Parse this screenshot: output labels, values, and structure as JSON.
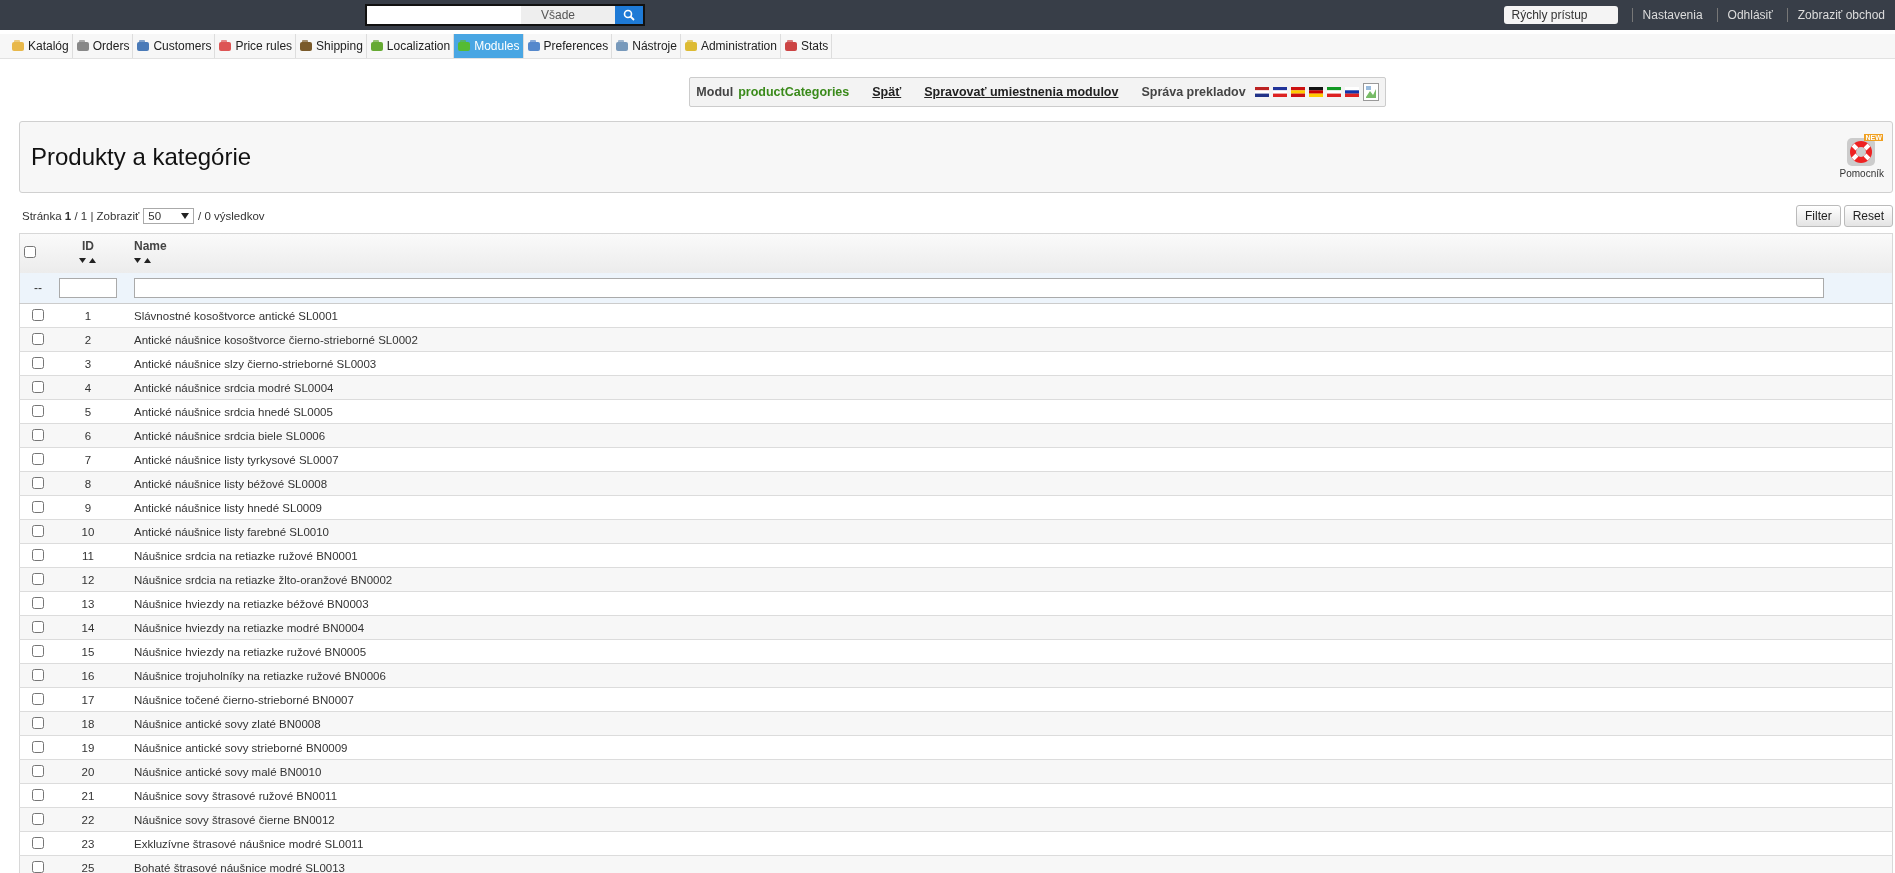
{
  "top_bar": {
    "search": {
      "scope": "Všade"
    },
    "quick_access": "Rýchly prístup",
    "links": [
      "Nastavenia",
      "Odhlásiť",
      "Zobraziť obchod"
    ]
  },
  "tabs": [
    {
      "label": "Katalóg",
      "selected": false
    },
    {
      "label": "Orders",
      "selected": false
    },
    {
      "label": "Customers",
      "selected": false
    },
    {
      "label": "Price rules",
      "selected": false
    },
    {
      "label": "Shipping",
      "selected": false
    },
    {
      "label": "Localization",
      "selected": false
    },
    {
      "label": "Modules",
      "selected": true
    },
    {
      "label": "Preferences",
      "selected": false
    },
    {
      "label": "Nástroje",
      "selected": false
    },
    {
      "label": "Administration",
      "selected": false
    },
    {
      "label": "Stats",
      "selected": false
    }
  ],
  "module_bar": {
    "label": "Modul",
    "module_name": "productCategories",
    "back_link": "Späť",
    "positions_link": "Spravovať umiestnenia modulov",
    "translations_label": "Správa prekladov"
  },
  "header": {
    "title": "Produkty a kategórie",
    "help_badge": "NEW",
    "help_label": "Pomocník"
  },
  "pagination": {
    "text": "Stránka **1** / 1 | Zobraziť",
    "per_page": "50",
    "results": "/ 0 výsledkov"
  },
  "buttons": [
    "Filter",
    "Reset"
  ],
  "table": {
    "select_all": {
      "checked": false
    },
    "columns": [
      "ID",
      "Name"
    ],
    "filter_marker": "--",
    "rows": [
      {
        "id": "1",
        "name": "Slávnostné kosoštvorce antické SL0001",
        "checked": false
      },
      {
        "id": "2",
        "name": "Antické náušnice kosoštvorce čierno-strieborné SL0002",
        "checked": false
      },
      {
        "id": "3",
        "name": "Antické náušnice slzy čierno-strieborné SL0003",
        "checked": false
      },
      {
        "id": "4",
        "name": "Antické náušnice srdcia modré SL0004",
        "checked": false
      },
      {
        "id": "5",
        "name": "Antické náušnice srdcia hnedé SL0005",
        "checked": false
      },
      {
        "id": "6",
        "name": "Antické náušnice srdcia biele SL0006",
        "checked": false
      },
      {
        "id": "7",
        "name": "Antické náušnice listy tyrkysové SL0007",
        "checked": false
      },
      {
        "id": "8",
        "name": "Antické náušnice listy béžové SL0008",
        "checked": false
      },
      {
        "id": "9",
        "name": "Antické náušnice listy hnedé SL0009",
        "checked": false
      },
      {
        "id": "10",
        "name": "Antické náušnice listy farebné SL0010",
        "checked": false
      },
      {
        "id": "11",
        "name": "Náušnice srdcia na retiazke ružové BN0001",
        "checked": false
      },
      {
        "id": "12",
        "name": "Náušnice srdcia na retiazke žlto-oranžové BN0002",
        "checked": false
      },
      {
        "id": "13",
        "name": "Náušnice hviezdy na retiazke béžové BN0003",
        "checked": false
      },
      {
        "id": "14",
        "name": "Náušnice hviezdy na retiazke modré BN0004",
        "checked": false
      },
      {
        "id": "15",
        "name": "Náušnice hviezdy na retiazke ružové BN0005",
        "checked": false
      },
      {
        "id": "16",
        "name": "Náušnice trojuholníky na retiazke ružové BN0006",
        "checked": false
      },
      {
        "id": "17",
        "name": "Náušnice točené čierno-strieborné BN0007",
        "checked": false
      },
      {
        "id": "18",
        "name": "Náušnice antické sovy zlaté BN0008",
        "checked": false
      },
      {
        "id": "19",
        "name": "Náušnice antické sovy strieborné BN0009",
        "checked": false
      },
      {
        "id": "20",
        "name": "Náušnice antické sovy malé BN0010",
        "checked": false
      },
      {
        "id": "21",
        "name": "Náušnice sovy štrasové ružové BN0011",
        "checked": false
      },
      {
        "id": "22",
        "name": "Náušnice sovy štrasové čierne BN0012",
        "checked": false
      },
      {
        "id": "23",
        "name": "Exkluzívne štrasové náušnice modré SL0011",
        "checked": false
      },
      {
        "id": "25",
        "name": "Bohaté štrasové náušnice modré SL0013",
        "checked": false
      }
    ]
  }
}
